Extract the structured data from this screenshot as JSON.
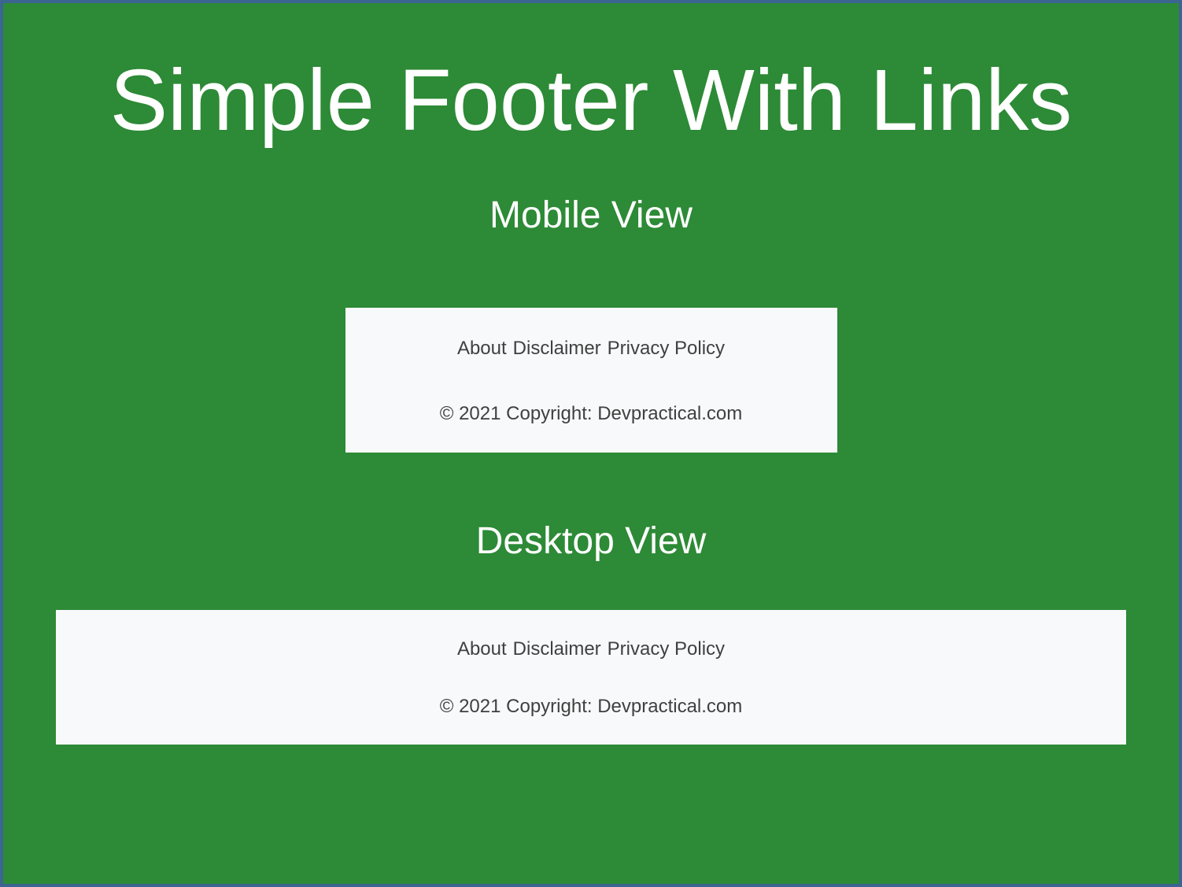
{
  "title": "Simple Footer With Links",
  "mobile": {
    "heading": "Mobile View",
    "links": {
      "about": "About",
      "disclaimer": "Disclaimer",
      "privacy": "Privacy Policy"
    },
    "copyright": "© 2021 Copyright: Devpractical.com"
  },
  "desktop": {
    "heading": "Desktop View",
    "links": {
      "about": "About",
      "disclaimer": "Disclaimer",
      "privacy": "Privacy Policy"
    },
    "copyright": "© 2021 Copyright: Devpractical.com"
  }
}
